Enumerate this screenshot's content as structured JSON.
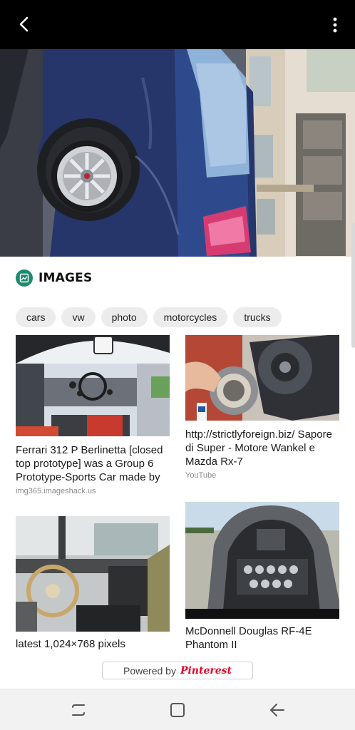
{
  "topbar": {
    "back_icon": "back-arrow-icon",
    "more_icon": "more-vertical-icon"
  },
  "images_section": {
    "icon": "image-icon",
    "icon_color": "#1f8a70",
    "title": "IMAGES"
  },
  "chips": [
    "cars",
    "vw",
    "photo",
    "motorcycles",
    "trucks"
  ],
  "results": [
    {
      "title": "Ferrari 312 P Berlinetta [closed top prototype] was a Group 6 Prototype-Sports Car made by",
      "source": "img365.imageshack.us"
    },
    {
      "title": "http://strictlyforeign.biz/ Sapore di Super - Motore Wankel e Mazda Rx-7",
      "source": "YouTube"
    },
    {
      "title": "latest 1,024×768 pixels",
      "source": ""
    },
    {
      "title": "McDonnell Douglas RF-4E Phantom II",
      "source": ""
    }
  ],
  "powered_by": {
    "label": "Powered by",
    "brand": "Pinterest",
    "brand_color": "#e60023"
  },
  "navbar": {
    "recents_icon": "recents-icon",
    "home_icon": "home-icon",
    "back_icon": "nav-back-icon"
  }
}
